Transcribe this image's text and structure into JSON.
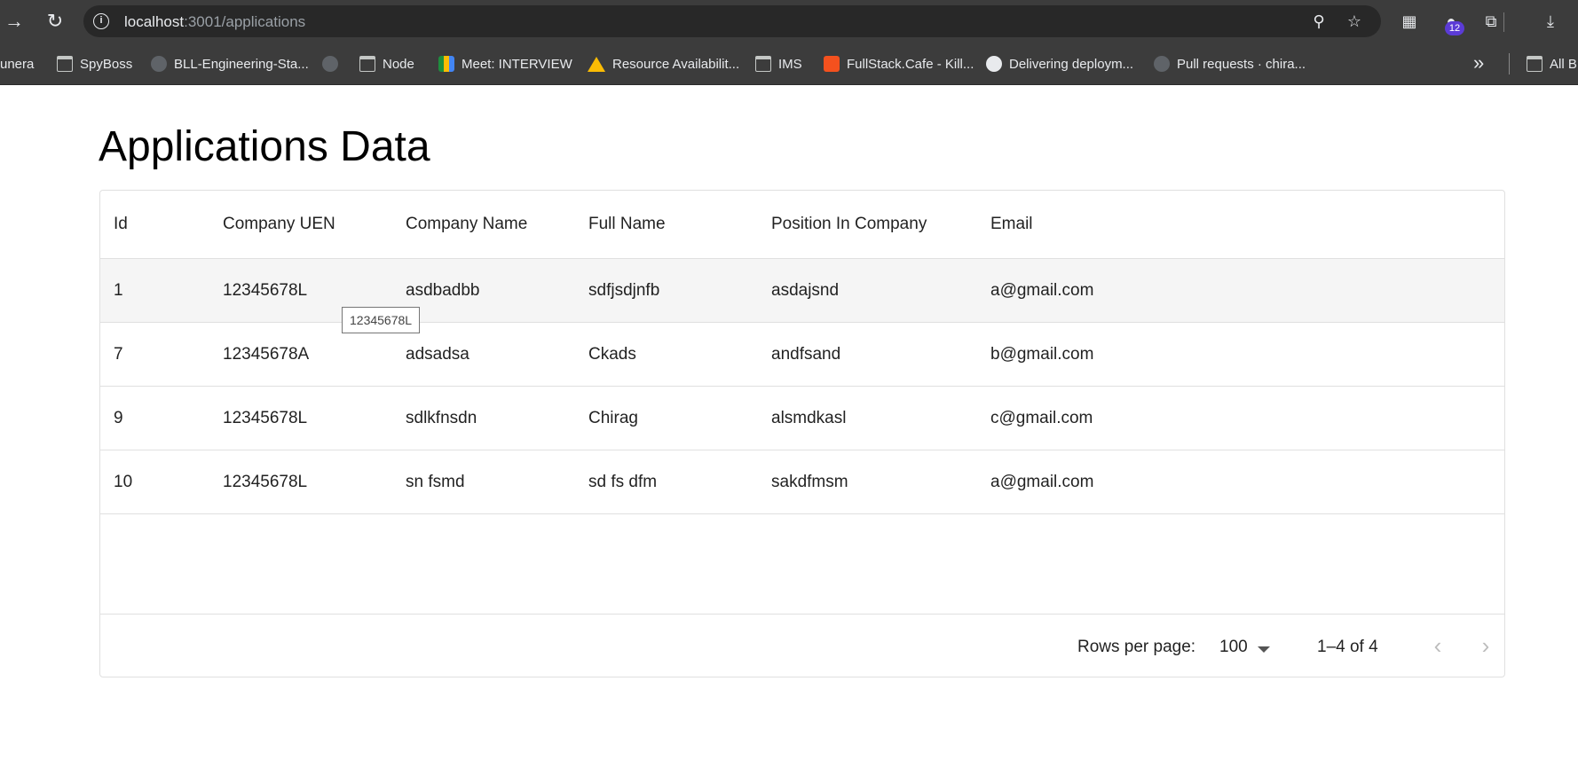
{
  "browser": {
    "url_host": "localhost",
    "url_path": ":3001/applications",
    "extension_badge": "12",
    "bookmarks": [
      {
        "label": "unera",
        "icon": "none"
      },
      {
        "label": "SpyBoss",
        "icon": "folder-icon"
      },
      {
        "label": "BLL-Engineering-Sta...",
        "icon": "github-icon"
      },
      {
        "label": "",
        "icon": "github-icon"
      },
      {
        "label": "Node",
        "icon": "folder-icon"
      },
      {
        "label": "Meet: INTERVIEW",
        "icon": "meet-icon"
      },
      {
        "label": "Resource Availabilit...",
        "icon": "drive-icon"
      },
      {
        "label": "IMS",
        "icon": "folder-icon"
      },
      {
        "label": "FullStack.Cafe - Kill...",
        "icon": "fullstack-cafe-icon"
      },
      {
        "label": "Delivering deploym...",
        "icon": "github-icon"
      },
      {
        "label": "Pull requests · chira...",
        "icon": "github-icon"
      },
      {
        "label": "All B",
        "icon": "folder-icon"
      }
    ]
  },
  "page": {
    "title": "Applications Data"
  },
  "table": {
    "columns": [
      "Id",
      "Company UEN",
      "Company Name",
      "Full Name",
      "Position In Company",
      "Email"
    ],
    "rows": [
      [
        "1",
        "12345678L",
        "asdbadbb",
        "sdfjsdjnfb",
        "asdajsnd",
        "a@gmail.com"
      ],
      [
        "7",
        "12345678A",
        "adsadsa",
        "Ckads",
        "andfsand",
        "b@gmail.com"
      ],
      [
        "9",
        "12345678L",
        "sdlkfnsdn",
        "Chirag",
        "alsmdkasl",
        "c@gmail.com"
      ],
      [
        "10",
        "12345678L",
        "sn fsmd",
        "sd fs dfm",
        "sakdfmsm",
        "a@gmail.com"
      ]
    ],
    "tooltip": "12345678L"
  },
  "pagination": {
    "rows_per_page_label": "Rows per page:",
    "rows_per_page_value": "100",
    "range": "1–4 of 4"
  }
}
